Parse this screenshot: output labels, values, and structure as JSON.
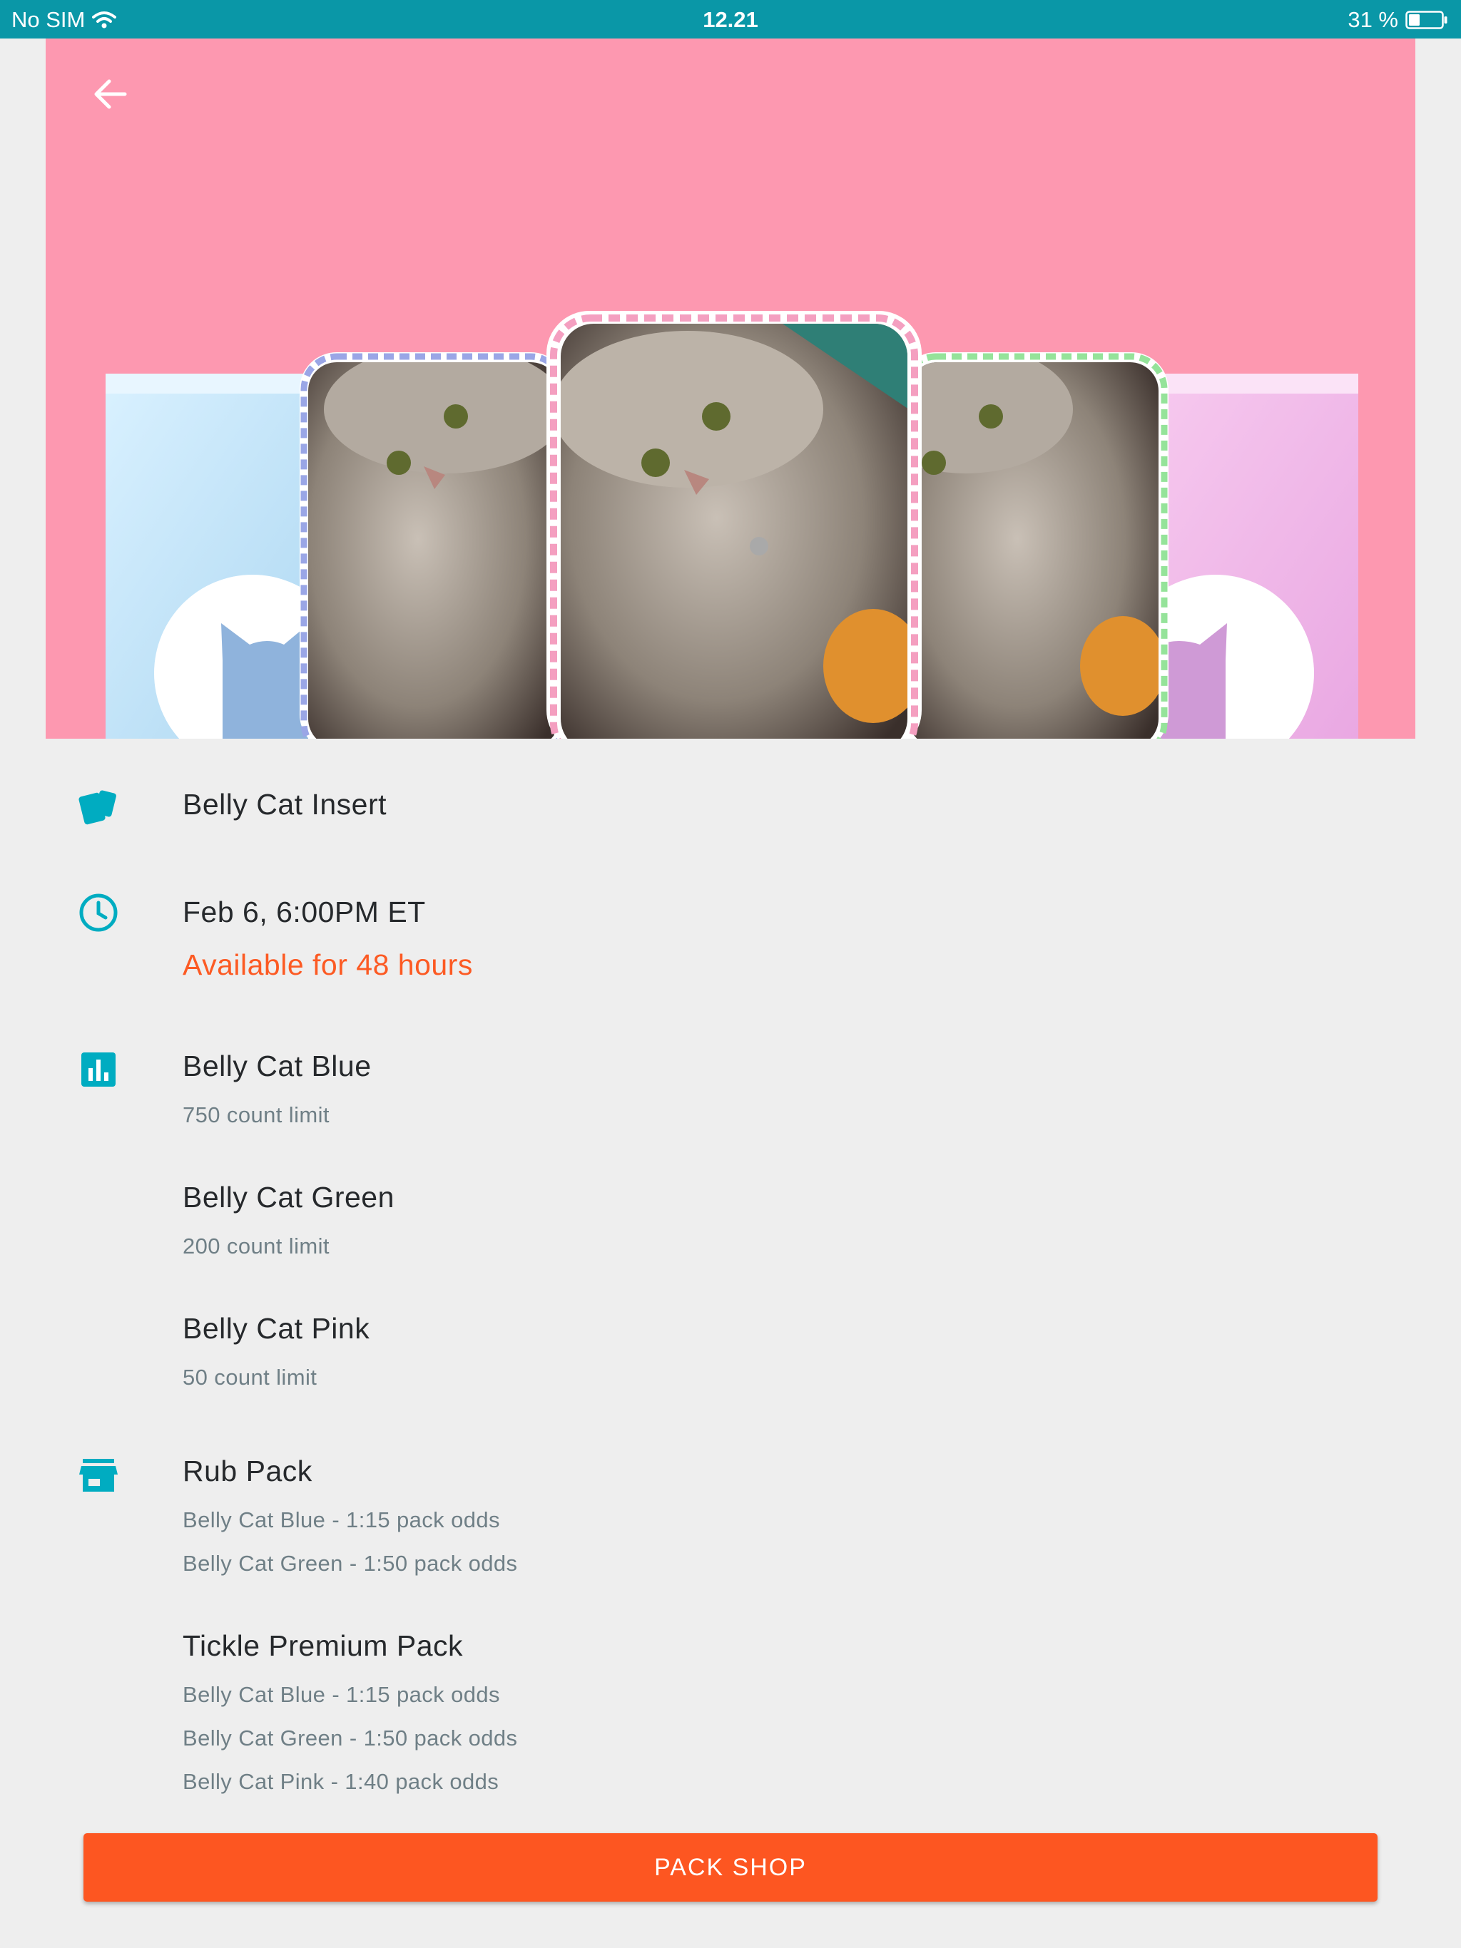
{
  "status": {
    "carrier": "No SIM",
    "time": "12.21",
    "battery": "31 %"
  },
  "hero": {
    "back_icon": "arrow-left-icon",
    "background_color": "#fd98b0"
  },
  "insert": {
    "icon": "cards-icon",
    "name": "Belly Cat Insert"
  },
  "release": {
    "icon": "clock-icon",
    "date": "Feb 6, 6:00PM ET",
    "availability": "Available for 48 hours"
  },
  "limits": {
    "icon": "bar-chart-icon",
    "items": [
      {
        "name": "Belly Cat Blue",
        "limit": "750 count limit"
      },
      {
        "name": "Belly Cat Green",
        "limit": "200 count limit"
      },
      {
        "name": "Belly Cat Pink",
        "limit": "50 count limit"
      }
    ]
  },
  "packs": {
    "icon": "store-icon",
    "items": [
      {
        "name": "Rub Pack",
        "odds": [
          "Belly Cat Blue - 1:15 pack odds",
          "Belly Cat Green - 1:50 pack odds"
        ]
      },
      {
        "name": "Tickle Premium Pack",
        "odds": [
          "Belly Cat Blue - 1:15 pack odds",
          "Belly Cat Green - 1:50 pack odds",
          "Belly Cat Pink - 1:40 pack odds"
        ]
      }
    ]
  },
  "cta": {
    "label": "PACK SHOP"
  },
  "colors": {
    "accent": "#00acc1",
    "cta": "#fd5621",
    "availability": "#fc5a23",
    "status_bar": "#0a97a7"
  }
}
